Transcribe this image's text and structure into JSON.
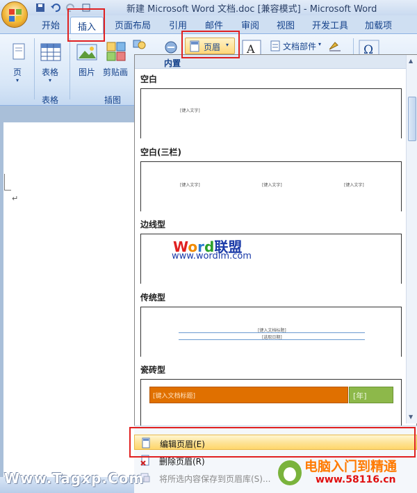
{
  "window": {
    "title": "新建 Microsoft Word 文档.doc [兼容模式] - Microsoft Word"
  },
  "tabs": [
    "开始",
    "插入",
    "页面布局",
    "引用",
    "邮件",
    "审阅",
    "视图",
    "开发工具",
    "加载项"
  ],
  "ribbon": {
    "page_btn": "页",
    "table_btn": "表格",
    "picture_btn": "图片",
    "clipart_btn": "剪贴画",
    "header_btn": "页眉",
    "quickparts_btn": "文档部件",
    "table_group": "表格",
    "illustration_group": "插图"
  },
  "gallery": {
    "header": "内置",
    "sections": [
      {
        "name": "空白"
      },
      {
        "name": "空白(三栏)"
      },
      {
        "name": "边线型"
      },
      {
        "name": "传统型"
      },
      {
        "name": "瓷砖型"
      }
    ],
    "placeholders": {
      "type_text": "[键入文字]",
      "doc_title": "[键入文档标题]",
      "select_date": "[选取日期]",
      "tile_title": "[键入文档标题]",
      "tile_year": "[年]"
    },
    "watermark_word": "Word联盟",
    "watermark_url": "www.wordlm.com"
  },
  "commands": [
    {
      "label": "编辑页眉(E)",
      "highlighted": true
    },
    {
      "label": "删除页眉(R)",
      "highlighted": false
    },
    {
      "label": "将所选内容保存到页眉库(S)...",
      "highlighted": false,
      "disabled": true
    }
  ],
  "watermarks": {
    "left": "Www.Tagxp.Com",
    "right_title": "电脑入门到精通",
    "right_url": "www.58116.cn"
  },
  "colors": {
    "ribbon_text": "#15428b",
    "highlight_border": "#e02020",
    "tile_orange": "#e07000",
    "tile_green": "#8db84a"
  }
}
